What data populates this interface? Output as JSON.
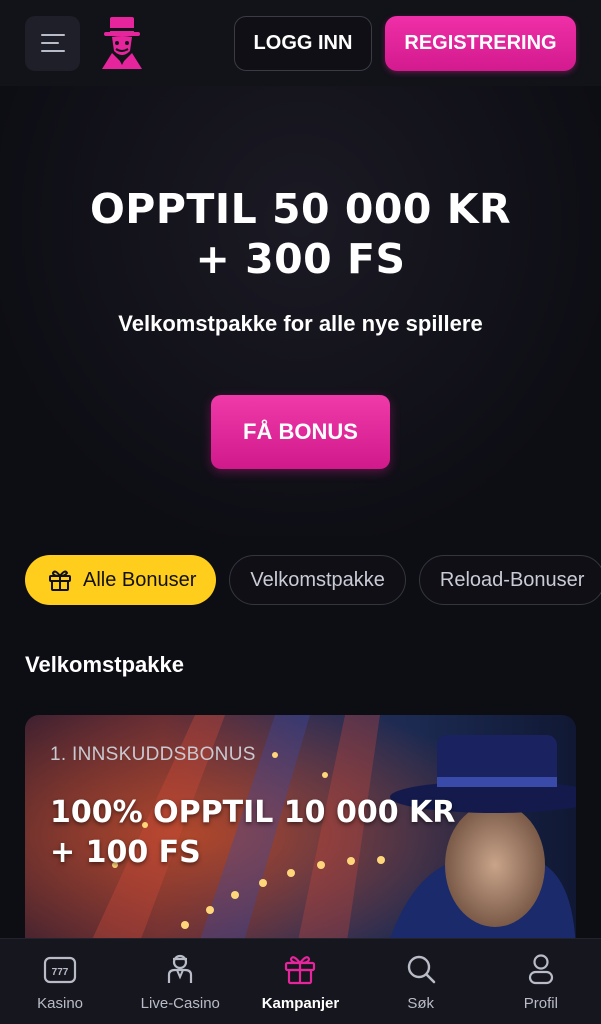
{
  "header": {
    "login_label": "LOGG INN",
    "register_label": "REGISTRERING"
  },
  "hero": {
    "title_line1": "OPPTIL 50 000 KR",
    "title_line2": "+ 300 FS",
    "subtitle": "Velkomstpakke for alle nye spillere",
    "cta_label": "FÅ BONUS"
  },
  "filters": [
    {
      "label": "Alle Bonuser",
      "active": true,
      "icon": "gift-icon"
    },
    {
      "label": "Velkomstpakke",
      "active": false
    },
    {
      "label": "Reload-Bonuser",
      "active": false
    }
  ],
  "section": {
    "title": "Velkomstpakke"
  },
  "promo_card": {
    "label": "1. INNSKUDDSBONUS",
    "title_line1": "100% OPPTIL 10 000 KR",
    "title_line2": "+ 100 FS"
  },
  "bottom_nav": [
    {
      "label": "Kasino",
      "icon": "slot-machine-icon"
    },
    {
      "label": "Live-Casino",
      "icon": "dealer-icon"
    },
    {
      "label": "Kampanjer",
      "icon": "gift-icon",
      "active": true
    },
    {
      "label": "Søk",
      "icon": "search-icon"
    },
    {
      "label": "Profil",
      "icon": "user-icon"
    }
  ],
  "colors": {
    "accent_pink": "#e6259d",
    "accent_yellow": "#ffce1c",
    "background": "#0d0d14"
  }
}
